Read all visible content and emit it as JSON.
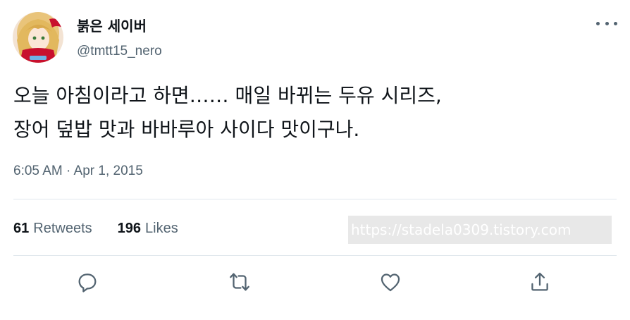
{
  "user": {
    "display_name": "붉은 세이버",
    "handle": "@tmtt15_nero"
  },
  "tweet": {
    "lines": [
      "오늘 아침이라고 하면…… 매일 바뀌는 두유 시리즈,",
      "장어 덮밥 맛과 바바루아 사이다 맛이구나."
    ],
    "timestamp": "6:05 AM · Apr 1, 2015"
  },
  "stats": {
    "retweets_count": "61",
    "retweets_label": "Retweets",
    "likes_count": "196",
    "likes_label": "Likes"
  },
  "watermark": "https://stadela0309.tistory.com",
  "icons": {
    "more": "more-horizontal-icon",
    "reply": "reply-icon",
    "retweet": "retweet-icon",
    "like": "heart-icon",
    "share": "share-icon"
  },
  "colors": {
    "text_primary": "#0f1419",
    "text_secondary": "#536471",
    "divider": "#e1e8ed"
  }
}
